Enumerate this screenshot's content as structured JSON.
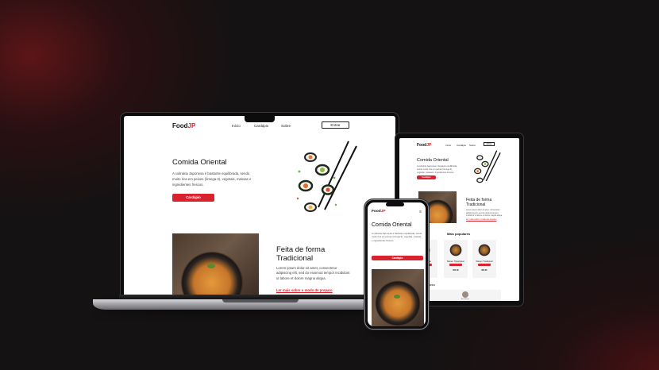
{
  "site": {
    "logo_main": "Food",
    "logo_accent": "JP",
    "nav": [
      "Início",
      "Cardápio",
      "Sobre"
    ],
    "enter_label": "Entrar",
    "hero": {
      "title": "Comida Oriental",
      "text": "A culinária Japonesa é bastante equilibrada, sendo muito rica em peixes (ômega 3), vegetais, massas e ingredientes frescos.",
      "button": "Cardápio"
    },
    "tradition": {
      "title_line1": "Feita de forma",
      "title_line2": "Tradicional",
      "text": "Lorem ipsum dolor sit amet, consectetur adipiscing elit, sed do eiusmod tempor incididunt ut labore et dolore magna aliqua.",
      "link": "Ler mais sobre o modo de preparo"
    },
    "popular": {
      "title": "Mais populares",
      "items": [
        {
          "name": "Frango",
          "price": "R$"
        },
        {
          "name": "Ramen Tipparamen",
          "price": "R$ 18"
        },
        {
          "name": "Ramen Tradicional",
          "price": "R$ 30"
        }
      ]
    },
    "depoimentos": {
      "title": "ários",
      "person": "Ana Bueno"
    },
    "phone_menu_icon": "≡"
  },
  "colors": {
    "accent": "#d9222e",
    "background": "#141213"
  }
}
